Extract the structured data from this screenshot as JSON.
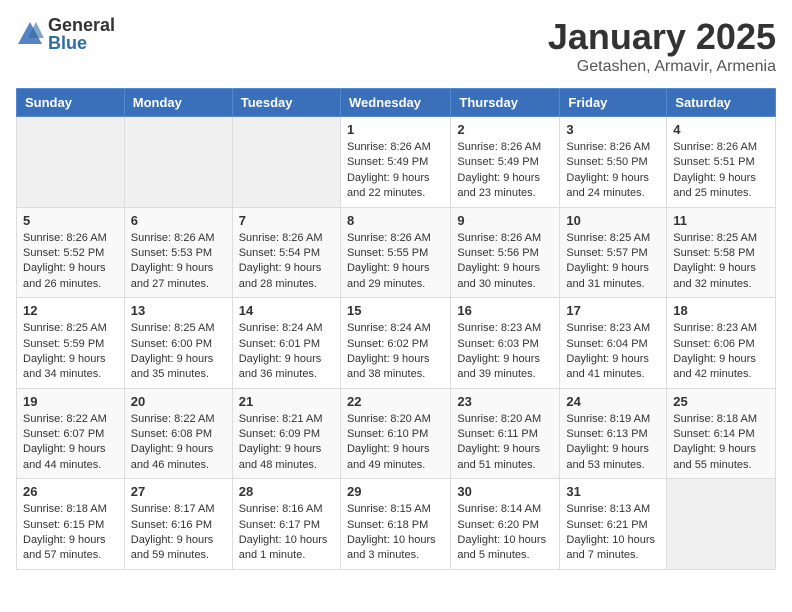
{
  "header": {
    "logo_general": "General",
    "logo_blue": "Blue",
    "month": "January 2025",
    "location": "Getashen, Armavir, Armenia"
  },
  "weekdays": [
    "Sunday",
    "Monday",
    "Tuesday",
    "Wednesday",
    "Thursday",
    "Friday",
    "Saturday"
  ],
  "weeks": [
    [
      {
        "day": "",
        "info": ""
      },
      {
        "day": "",
        "info": ""
      },
      {
        "day": "",
        "info": ""
      },
      {
        "day": "1",
        "info": "Sunrise: 8:26 AM\nSunset: 5:49 PM\nDaylight: 9 hours\nand 22 minutes."
      },
      {
        "day": "2",
        "info": "Sunrise: 8:26 AM\nSunset: 5:49 PM\nDaylight: 9 hours\nand 23 minutes."
      },
      {
        "day": "3",
        "info": "Sunrise: 8:26 AM\nSunset: 5:50 PM\nDaylight: 9 hours\nand 24 minutes."
      },
      {
        "day": "4",
        "info": "Sunrise: 8:26 AM\nSunset: 5:51 PM\nDaylight: 9 hours\nand 25 minutes."
      }
    ],
    [
      {
        "day": "5",
        "info": "Sunrise: 8:26 AM\nSunset: 5:52 PM\nDaylight: 9 hours\nand 26 minutes."
      },
      {
        "day": "6",
        "info": "Sunrise: 8:26 AM\nSunset: 5:53 PM\nDaylight: 9 hours\nand 27 minutes."
      },
      {
        "day": "7",
        "info": "Sunrise: 8:26 AM\nSunset: 5:54 PM\nDaylight: 9 hours\nand 28 minutes."
      },
      {
        "day": "8",
        "info": "Sunrise: 8:26 AM\nSunset: 5:55 PM\nDaylight: 9 hours\nand 29 minutes."
      },
      {
        "day": "9",
        "info": "Sunrise: 8:26 AM\nSunset: 5:56 PM\nDaylight: 9 hours\nand 30 minutes."
      },
      {
        "day": "10",
        "info": "Sunrise: 8:25 AM\nSunset: 5:57 PM\nDaylight: 9 hours\nand 31 minutes."
      },
      {
        "day": "11",
        "info": "Sunrise: 8:25 AM\nSunset: 5:58 PM\nDaylight: 9 hours\nand 32 minutes."
      }
    ],
    [
      {
        "day": "12",
        "info": "Sunrise: 8:25 AM\nSunset: 5:59 PM\nDaylight: 9 hours\nand 34 minutes."
      },
      {
        "day": "13",
        "info": "Sunrise: 8:25 AM\nSunset: 6:00 PM\nDaylight: 9 hours\nand 35 minutes."
      },
      {
        "day": "14",
        "info": "Sunrise: 8:24 AM\nSunset: 6:01 PM\nDaylight: 9 hours\nand 36 minutes."
      },
      {
        "day": "15",
        "info": "Sunrise: 8:24 AM\nSunset: 6:02 PM\nDaylight: 9 hours\nand 38 minutes."
      },
      {
        "day": "16",
        "info": "Sunrise: 8:23 AM\nSunset: 6:03 PM\nDaylight: 9 hours\nand 39 minutes."
      },
      {
        "day": "17",
        "info": "Sunrise: 8:23 AM\nSunset: 6:04 PM\nDaylight: 9 hours\nand 41 minutes."
      },
      {
        "day": "18",
        "info": "Sunrise: 8:23 AM\nSunset: 6:06 PM\nDaylight: 9 hours\nand 42 minutes."
      }
    ],
    [
      {
        "day": "19",
        "info": "Sunrise: 8:22 AM\nSunset: 6:07 PM\nDaylight: 9 hours\nand 44 minutes."
      },
      {
        "day": "20",
        "info": "Sunrise: 8:22 AM\nSunset: 6:08 PM\nDaylight: 9 hours\nand 46 minutes."
      },
      {
        "day": "21",
        "info": "Sunrise: 8:21 AM\nSunset: 6:09 PM\nDaylight: 9 hours\nand 48 minutes."
      },
      {
        "day": "22",
        "info": "Sunrise: 8:20 AM\nSunset: 6:10 PM\nDaylight: 9 hours\nand 49 minutes."
      },
      {
        "day": "23",
        "info": "Sunrise: 8:20 AM\nSunset: 6:11 PM\nDaylight: 9 hours\nand 51 minutes."
      },
      {
        "day": "24",
        "info": "Sunrise: 8:19 AM\nSunset: 6:13 PM\nDaylight: 9 hours\nand 53 minutes."
      },
      {
        "day": "25",
        "info": "Sunrise: 8:18 AM\nSunset: 6:14 PM\nDaylight: 9 hours\nand 55 minutes."
      }
    ],
    [
      {
        "day": "26",
        "info": "Sunrise: 8:18 AM\nSunset: 6:15 PM\nDaylight: 9 hours\nand 57 minutes."
      },
      {
        "day": "27",
        "info": "Sunrise: 8:17 AM\nSunset: 6:16 PM\nDaylight: 9 hours\nand 59 minutes."
      },
      {
        "day": "28",
        "info": "Sunrise: 8:16 AM\nSunset: 6:17 PM\nDaylight: 10 hours\nand 1 minute."
      },
      {
        "day": "29",
        "info": "Sunrise: 8:15 AM\nSunset: 6:18 PM\nDaylight: 10 hours\nand 3 minutes."
      },
      {
        "day": "30",
        "info": "Sunrise: 8:14 AM\nSunset: 6:20 PM\nDaylight: 10 hours\nand 5 minutes."
      },
      {
        "day": "31",
        "info": "Sunrise: 8:13 AM\nSunset: 6:21 PM\nDaylight: 10 hours\nand 7 minutes."
      },
      {
        "day": "",
        "info": ""
      }
    ]
  ]
}
